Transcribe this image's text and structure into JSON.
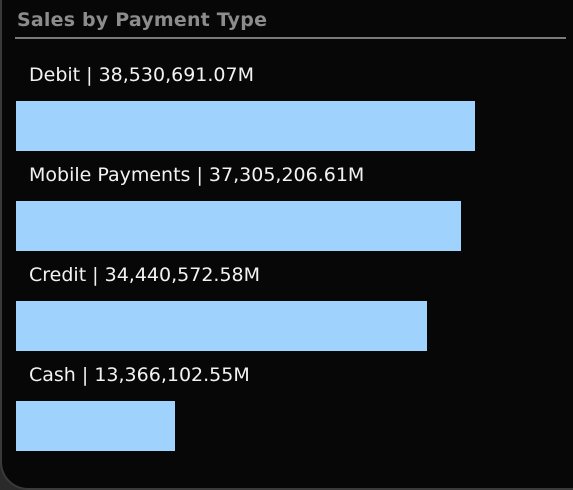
{
  "title": "Sales by Payment Type",
  "colors": {
    "bar": "#9fd3fe",
    "background": "#070707",
    "title": "#8c8c8c",
    "label": "#f2f2f2"
  },
  "chart_data": {
    "type": "bar",
    "orientation": "horizontal",
    "title": "Sales by Payment Type",
    "categories": [
      "Debit",
      "Mobile Payments",
      "Credit",
      "Cash"
    ],
    "values": [
      38530691.07,
      37305206.61,
      34440572.58,
      13366102.55
    ],
    "labels": [
      "Debit | 38,530,691.07M",
      "Mobile Payments | 37,305,206.61M",
      "Credit | 34,440,572.58M",
      "Cash | 13,366,102.55M"
    ],
    "xlim": [
      0,
      39680000
    ],
    "grid": false,
    "legend": "none"
  }
}
